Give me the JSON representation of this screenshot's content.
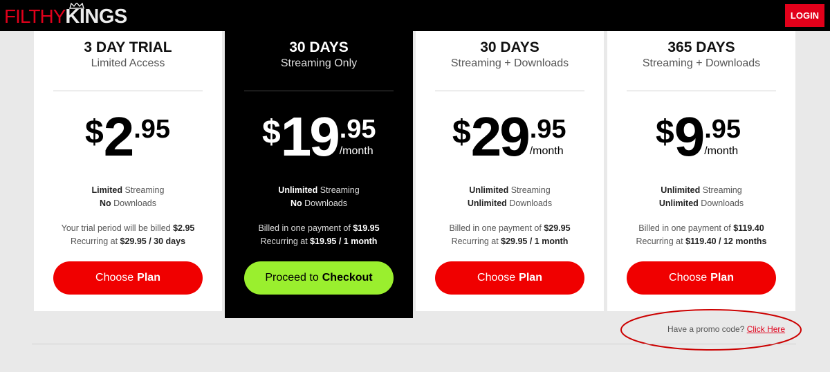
{
  "header": {
    "logo_part1": "FILTHY",
    "logo_part2": "KINGS",
    "login_label": "LOGIN"
  },
  "plans": [
    {
      "title": "3 DAY TRIAL",
      "subtitle": "Limited Access",
      "currency": "$",
      "dollars": "2",
      "cents": ".95",
      "period": "",
      "feature1_bold": "Limited",
      "feature1_text": " Streaming",
      "feature2_bold": "No",
      "feature2_text": " Downloads",
      "billing1_text": "Your trial period will be billed ",
      "billing1_bold": "$2.95",
      "billing2_text": "Recurring at ",
      "billing2_bold": "$29.95 / 30 days",
      "button_text": "Choose",
      "button_bold": "Plan"
    },
    {
      "title": "30 DAYS",
      "subtitle": "Streaming Only",
      "currency": "$",
      "dollars": "19",
      "cents": ".95",
      "period": "/month",
      "feature1_bold": "Unlimited",
      "feature1_text": " Streaming",
      "feature2_bold": "No",
      "feature2_text": " Downloads",
      "billing1_text": "Billed in one payment of ",
      "billing1_bold": "$19.95",
      "billing2_text": "Recurring at ",
      "billing2_bold": "$19.95 / 1 month",
      "button_text": "Proceed to",
      "button_bold": "Checkout",
      "selected": true
    },
    {
      "title": "30 DAYS",
      "subtitle": "Streaming + Downloads",
      "currency": "$",
      "dollars": "29",
      "cents": ".95",
      "period": "/month",
      "feature1_bold": "Unlimited",
      "feature1_text": " Streaming",
      "feature2_bold": "Unlimited",
      "feature2_text": " Downloads",
      "billing1_text": "Billed in one payment of ",
      "billing1_bold": "$29.95",
      "billing2_text": "Recurring at ",
      "billing2_bold": "$29.95 / 1 month",
      "button_text": "Choose",
      "button_bold": "Plan"
    },
    {
      "title": "365 DAYS",
      "subtitle": "Streaming + Downloads",
      "currency": "$",
      "dollars": "9",
      "cents": ".95",
      "period": "/month",
      "feature1_bold": "Unlimited",
      "feature1_text": " Streaming",
      "feature2_bold": "Unlimited",
      "feature2_text": " Downloads",
      "billing1_text": "Billed in one payment of ",
      "billing1_bold": "$119.40",
      "billing2_text": "Recurring at ",
      "billing2_bold": "$119.40 / 12 months",
      "button_text": "Choose",
      "button_bold": "Plan"
    }
  ],
  "promo": {
    "text": "Have a promo code? ",
    "link": "Click Here"
  },
  "colors": {
    "brand_red": "#e2001a",
    "button_red": "#f00000",
    "checkout_green": "#9aef2e",
    "annotation_red": "#cc0000"
  }
}
